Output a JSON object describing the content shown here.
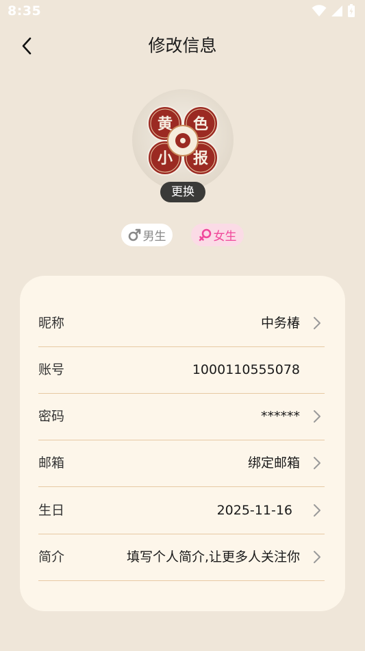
{
  "status_bar": {
    "time": "8:35"
  },
  "header": {
    "title": "修改信息"
  },
  "avatar": {
    "change_label": "更换",
    "logo_chars": [
      "黄",
      "色",
      "小",
      "报"
    ],
    "logo_color": "#9b2a22"
  },
  "gender": {
    "male_label": "男生",
    "female_label": "女生",
    "selected": "female"
  },
  "fields": [
    {
      "label": "昵称",
      "value": "中务椿",
      "arrow": true
    },
    {
      "label": "账号",
      "value": "1000110555078",
      "arrow": false
    },
    {
      "label": "密码",
      "value": "******",
      "arrow": true
    },
    {
      "label": "邮箱",
      "value": "绑定邮箱",
      "arrow": true
    },
    {
      "label": "生日",
      "value": "2025-11-16",
      "arrow": true
    },
    {
      "label": "简介",
      "value": "填写个人简介,让更多人关注你",
      "arrow": true
    }
  ],
  "colors": {
    "background": "#efe6d9",
    "card": "#fdf6ea",
    "divider": "#e7c9a3",
    "female_accent": "#f0479a"
  }
}
